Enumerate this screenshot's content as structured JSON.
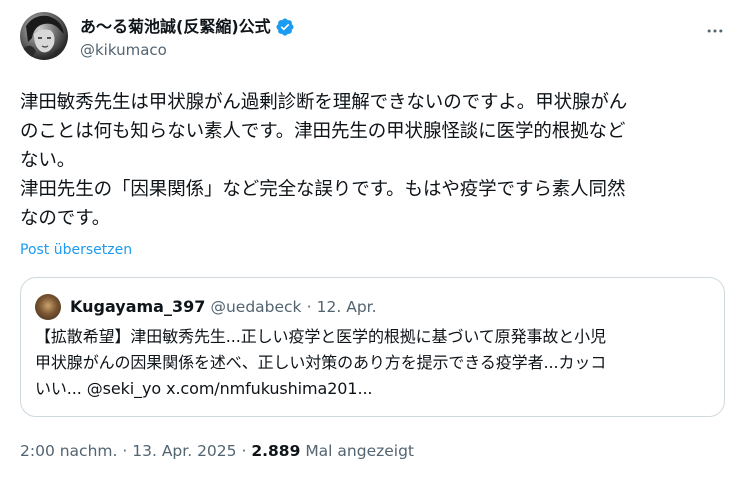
{
  "author": {
    "display_name": "あ〜る菊池誠(反緊縮)公式",
    "handle": "@kikumaco",
    "avatar_icon": "avatar-illustration",
    "verified_icon": "verified-badge-icon",
    "verified_color": "#1d9bf0"
  },
  "menu": {
    "icon": "more-options-icon"
  },
  "post": {
    "text": "津田敏秀先生は甲状腺がん過剰診断を理解できないのですよ。甲状腺がん\nのことは何も知らない素人です。津田先生の甲状腺怪談に医学的根拠など\nない。\n津田先生の「因果関係」など完全な誤りです。もはや疫学ですら素人同然\nなのです。",
    "translate_label": "Post übersetzen"
  },
  "quote": {
    "display_name": "Kugayama_397",
    "handle": "@uedabeck",
    "separator": "·",
    "date": "12. Apr.",
    "text": "【拡散希望】津田敏秀先生...正しい疫学と医学的根拠に基づいて原発事故と小児\n甲状腺がんの因果関係を述べ、正しい対策のあり方を提示できる疫学者...カッコ\nいい... @seki_yo x.com/nmfukushima201..."
  },
  "meta": {
    "time": "2:00 nachm.",
    "sep1": "·",
    "date": "13. Apr. 2025",
    "sep2": "·",
    "views": "2.889",
    "views_label": "Mal angezeigt"
  },
  "colors": {
    "text": "#0f1419",
    "secondary": "#536471",
    "link": "#1d9bf0",
    "border": "#cfd9de"
  }
}
